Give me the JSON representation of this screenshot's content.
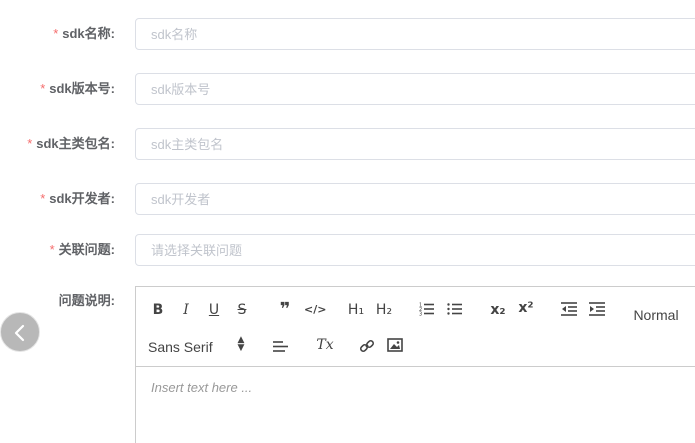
{
  "form": {
    "required_mark": "*",
    "fields": [
      {
        "label": "sdk名称:",
        "placeholder": "sdk名称"
      },
      {
        "label": "sdk版本号:",
        "placeholder": "sdk版本号"
      },
      {
        "label": "sdk主类包名:",
        "placeholder": "sdk主类包名"
      },
      {
        "label": "sdk开发者:",
        "placeholder": "sdk开发者"
      },
      {
        "label": "关联问题:",
        "placeholder": "请选择关联问题"
      }
    ],
    "description_label": "问题说明:"
  },
  "editor": {
    "bold": "B",
    "italic": "I",
    "underline": "U",
    "strike": "S",
    "blockquote": "❞",
    "code": "</>",
    "h1": "H₁",
    "h2": "H₂",
    "subscript": "x₂",
    "superscript": "x²",
    "size_value": "Normal",
    "font_value": "Sans Serif",
    "clean": "Tx",
    "placeholder": "Insert text here ..."
  },
  "colors": {
    "required": "#f56c6c",
    "label": "#606266",
    "border": "#dcdfe6",
    "placeholder": "#c0c4cc",
    "back_button": "#b8b8b8"
  }
}
